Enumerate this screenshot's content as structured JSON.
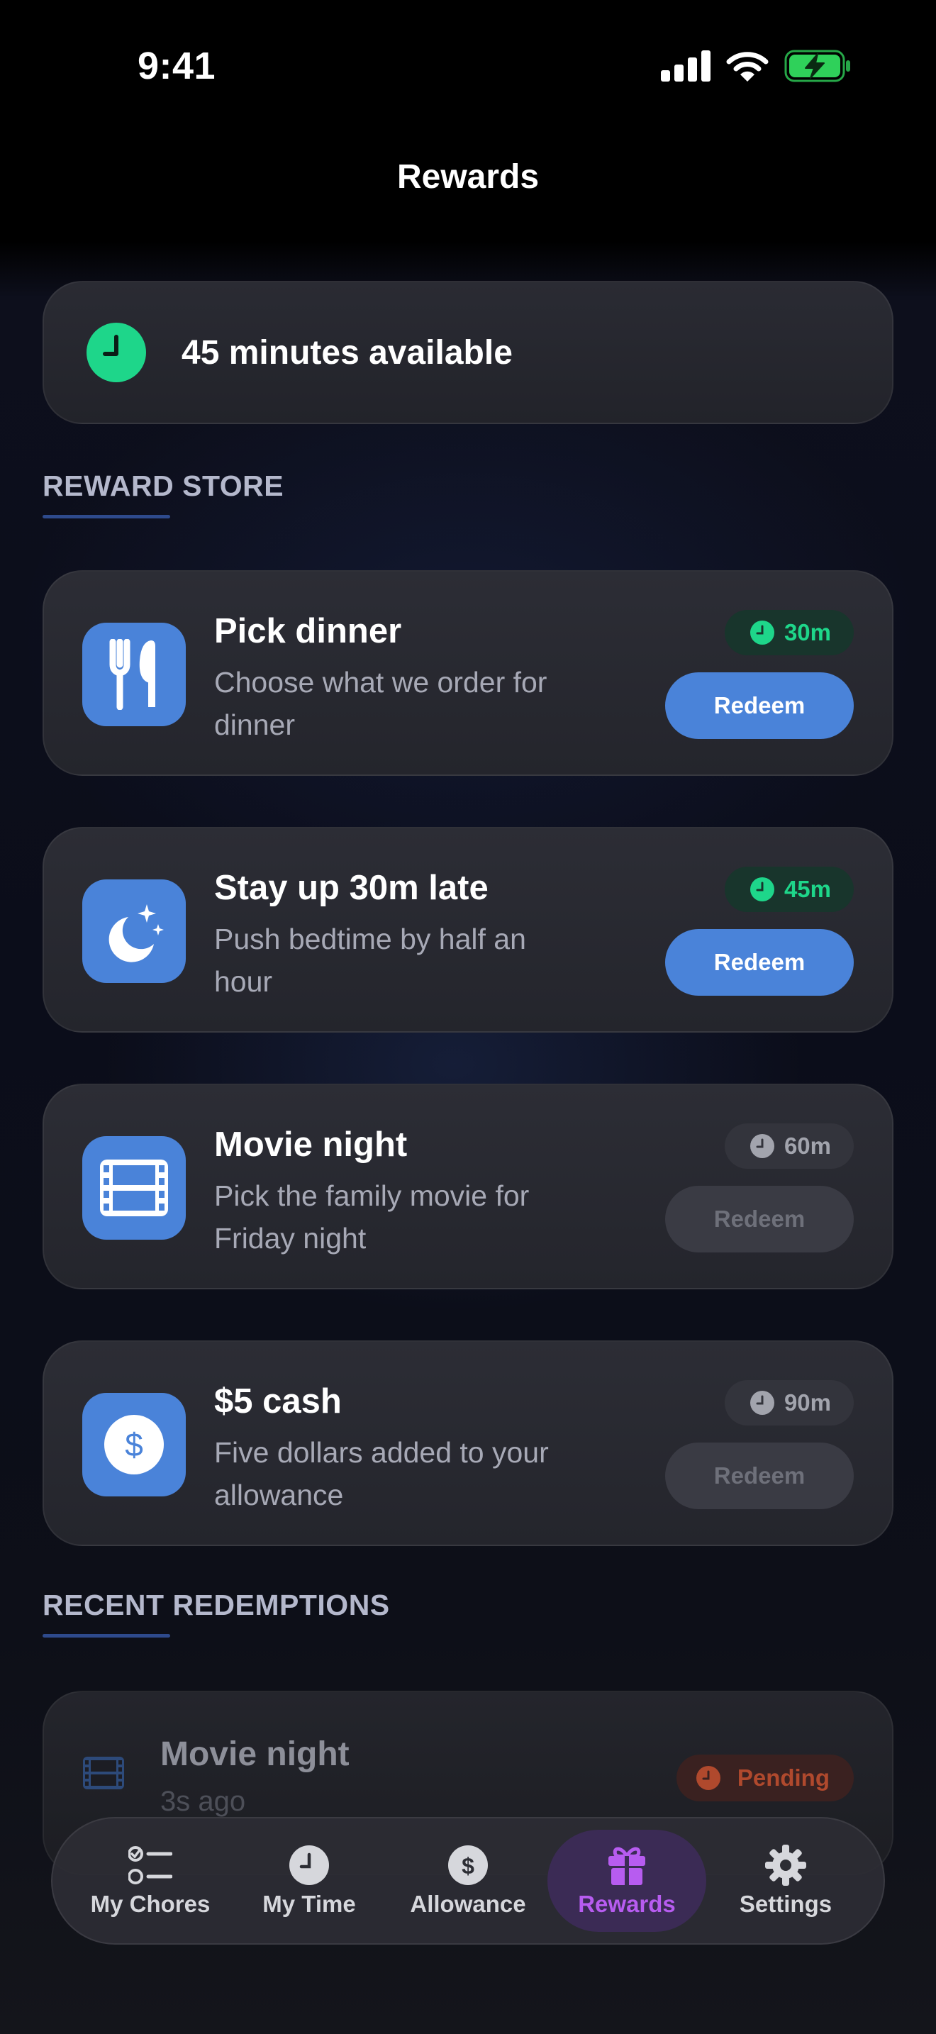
{
  "status_bar": {
    "time": "9:41"
  },
  "header": {
    "title": "Rewards"
  },
  "balance": {
    "text": "45 minutes available"
  },
  "reward_store": {
    "title": "REWARD STORE",
    "items": [
      {
        "title": "Pick dinner",
        "desc": "Choose what we order for dinner",
        "cost": "30m",
        "affordable": true,
        "button": "Redeem",
        "icon": "fork-knife-icon"
      },
      {
        "title": "Stay up 30m late",
        "desc": "Push bedtime by half an hour",
        "cost": "45m",
        "affordable": true,
        "button": "Redeem",
        "icon": "moon-stars-icon"
      },
      {
        "title": "Movie night",
        "desc": "Pick the family movie for Friday night",
        "cost": "60m",
        "affordable": false,
        "button": "Redeem",
        "icon": "film-icon"
      },
      {
        "title": "$5 cash",
        "desc": "Five dollars added to your allowance",
        "cost": "90m",
        "affordable": false,
        "button": "Redeem",
        "icon": "dollar-icon"
      }
    ]
  },
  "recent": {
    "title": "RECENT REDEMPTIONS",
    "items": [
      {
        "title": "Movie night",
        "time": "3s ago",
        "status": "Pending",
        "icon": "film-icon"
      }
    ]
  },
  "tabs": [
    {
      "label": "My Chores",
      "icon": "checklist-icon",
      "active": false
    },
    {
      "label": "My Time",
      "icon": "clock-icon",
      "active": false
    },
    {
      "label": "Allowance",
      "icon": "dollar-icon",
      "active": false
    },
    {
      "label": "Rewards",
      "icon": "gift-icon",
      "active": true
    },
    {
      "label": "Settings",
      "icon": "gear-icon",
      "active": false
    }
  ],
  "colors": {
    "accent_blue": "#4a83d9",
    "available_green": "#1ed68a",
    "active_tab_purple": "#b75cf0",
    "pending_orange": "#b0492d"
  }
}
